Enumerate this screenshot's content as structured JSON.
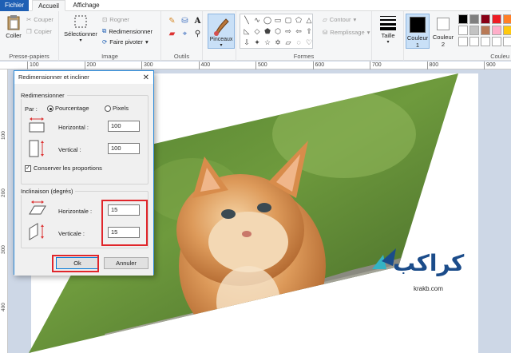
{
  "tabs": {
    "file": "Fichier",
    "home": "Accueil",
    "view": "Affichage"
  },
  "clipboard": {
    "paste": "Coller",
    "cut": "Couper",
    "copy": "Copier",
    "label": "Presse-papiers"
  },
  "image_group": {
    "select": "Sélectionner",
    "crop": "Rogner",
    "resize": "Redimensionner",
    "rotate": "Faire pivoter",
    "label": "Image"
  },
  "tools_group": {
    "label": "Outils",
    "brushes": "Pinceaux"
  },
  "shapes_group": {
    "outline": "Contour",
    "fill": "Remplissage",
    "label": "Formes"
  },
  "size_label": "Taille",
  "colors_group": {
    "color1": "Couleur 1",
    "color2": "Couleur 2",
    "label": "Couleu",
    "swatches": [
      "#000000",
      "#7f7f7f",
      "#880015",
      "#ed1c24",
      "#ff7f27",
      "#fff200",
      "#22b14c",
      "#ffffff",
      "#c3c3c3",
      "#b97a57",
      "#ffaec9",
      "#ffc90e",
      "#efe4b0",
      "#b5e61d",
      "#ffffff",
      "#ffffff",
      "#ffffff",
      "#ffffff",
      "#ffffff",
      "#ffffff",
      "#ffffff"
    ]
  },
  "ruler_h": [
    "100",
    "200",
    "300",
    "400",
    "500",
    "600",
    "700",
    "800",
    "900"
  ],
  "ruler_v": [
    "100",
    "200",
    "300",
    "400"
  ],
  "dialog": {
    "title": "Redimensionner et incliner",
    "resize_legend": "Redimensionner",
    "by_label": "Par :",
    "percent": "Pourcentage",
    "pixels": "Pixels",
    "horizontal": "Horizontal :",
    "horizontal_value": "100",
    "vertical": "Vertical :",
    "vertical_value": "100",
    "keep_ratio": "Conserver les proportions",
    "skew_legend": "Inclinaison (degrés)",
    "skew_h": "Horizontale :",
    "skew_h_value": "15",
    "skew_v": "Verticale :",
    "skew_v_value": "15",
    "ok": "Ok",
    "cancel": "Annuler"
  },
  "watermark": {
    "text": "كراكب",
    "url": "krakb.com"
  }
}
